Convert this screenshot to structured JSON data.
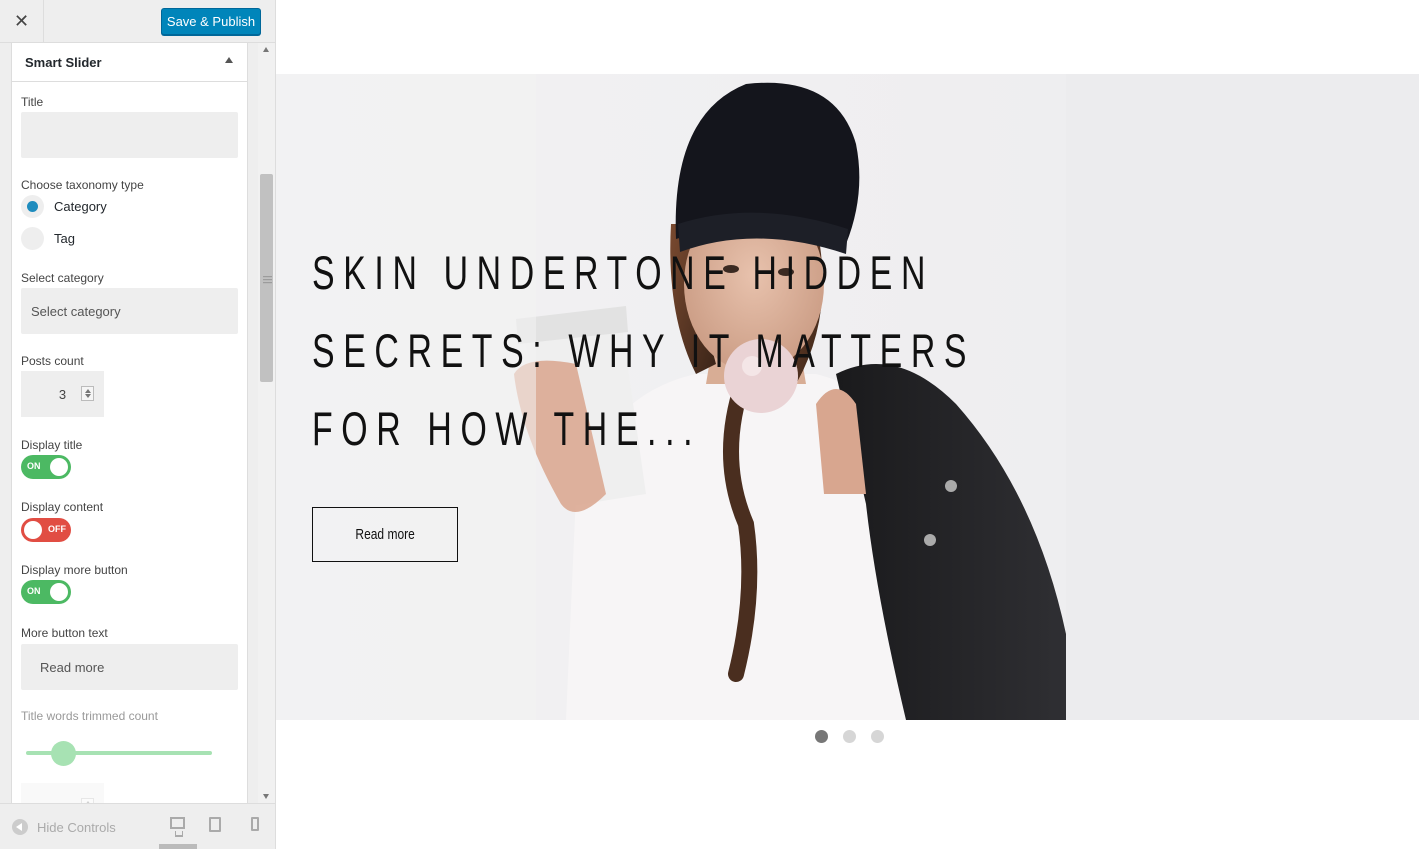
{
  "topbar": {
    "close_glyph": "✕",
    "publish_label": "Save & Publish"
  },
  "section": {
    "title": "Smart Slider"
  },
  "form": {
    "title_label": "Title",
    "title_value": "",
    "taxonomy_label": "Choose taxonomy type",
    "taxonomy_options": [
      {
        "label": "Category",
        "selected": true
      },
      {
        "label": "Tag",
        "selected": false
      }
    ],
    "category_label": "Select category",
    "category_value": "Select category",
    "posts_count_label": "Posts count",
    "posts_count_value": "3",
    "display_title_label": "Display title",
    "display_title_state": "ON",
    "display_content_label": "Display content",
    "display_content_state": "OFF",
    "display_more_label": "Display more button",
    "display_more_state": "ON",
    "more_text_label": "More button text",
    "more_text_value": "Read more",
    "trim_label": "Title words trimmed count",
    "trim_value": 0.2,
    "toggle_on_color": "#4cb963",
    "toggle_off_color": "#e14d43"
  },
  "footer": {
    "hide_controls_label": "Hide Controls",
    "devices": [
      "desktop-icon",
      "tablet-icon",
      "mobile-icon"
    ]
  },
  "preview": {
    "slide_title": "SKIN UNDERTONE HIDDEN SECRETS: WHY IT MATTERS FOR HOW THE...",
    "read_more_label": "Read more",
    "slides_count": 3,
    "active_slide": 1
  },
  "colors": {
    "accent": "#0085ba",
    "radio_selected": "#1e8cbe"
  }
}
